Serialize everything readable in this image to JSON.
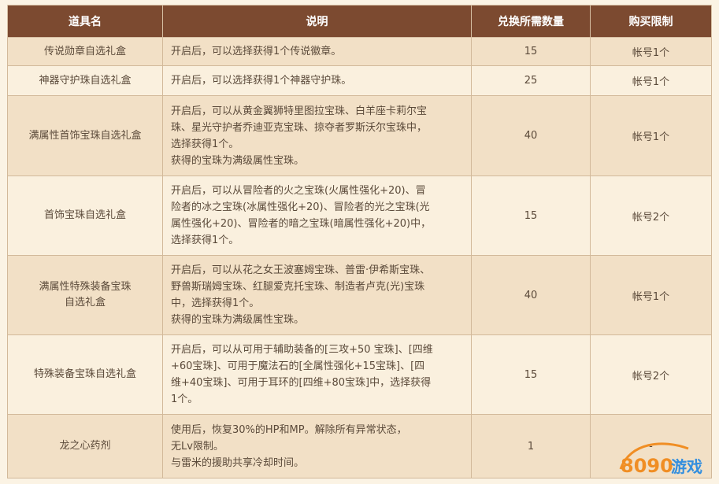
{
  "table": {
    "headers": [
      "道具名",
      "说明",
      "兑换所需数量",
      "购买限制"
    ],
    "rows": [
      {
        "name_lines": [
          "传说勋章自选礼盒"
        ],
        "desc_lines": [
          "开启后，可以选择获得1个传说徽章。"
        ],
        "qty": "15",
        "limit": "帐号1个"
      },
      {
        "name_lines": [
          "神器守护珠自选礼盒"
        ],
        "desc_lines": [
          "开启后，可以选择获得1个神器守护珠。"
        ],
        "qty": "25",
        "limit": "帐号1个"
      },
      {
        "name_lines": [
          "满属性首饰宝珠自选礼盒"
        ],
        "desc_lines": [
          "开启后，可以从黄金翼狮特里图拉宝珠、白羊座卡莉尔宝",
          "珠、星光守护者乔迪亚克宝珠、掠夺者罗斯沃尔宝珠中，",
          "选择获得1个。",
          "获得的宝珠为满级属性宝珠。"
        ],
        "qty": "40",
        "limit": "帐号1个"
      },
      {
        "name_lines": [
          "首饰宝珠自选礼盒"
        ],
        "desc_lines": [
          "开启后，可以从冒险者的火之宝珠(火属性强化+20)、冒",
          "险者的冰之宝珠(冰属性强化+20)、冒险者的光之宝珠(光",
          "属性强化+20)、冒险者的暗之宝珠(暗属性强化+20)中，",
          "选择获得1个。"
        ],
        "qty": "15",
        "limit": "帐号2个"
      },
      {
        "name_lines": [
          "满属性特殊装备宝珠",
          "自选礼盒"
        ],
        "desc_lines": [
          "开启后，可以从花之女王波塞姆宝珠、普雷·伊希斯宝珠、",
          "野兽斯瑞姆宝珠、红腿爱克托宝珠、制造者卢克(光)宝珠",
          "中，选择获得1个。",
          "获得的宝珠为满级属性宝珠。"
        ],
        "qty": "40",
        "limit": "帐号1个"
      },
      {
        "name_lines": [
          "特殊装备宝珠自选礼盒"
        ],
        "desc_lines": [
          "开启后，可以从可用于辅助装备的[三攻+50 宝珠]、[四维",
          "+60宝珠]、可用于魔法石的[全属性强化+15宝珠]、[四",
          "维+40宝珠]、可用于耳环的[四维+80宝珠]中，选择获得",
          "1个。"
        ],
        "qty": "15",
        "limit": "帐号2个"
      },
      {
        "name_lines": [
          "龙之心药剂"
        ],
        "desc_lines": [
          "使用后，恢复30%的HP和MP。解除所有异常状态，",
          "无Lv限制。",
          "与雷米的援助共享冷却时间。"
        ],
        "qty": "1",
        "limit": "-"
      }
    ]
  },
  "watermark": {
    "text": "8090游戏",
    "colors": {
      "orange": "#f08a1c",
      "blue": "#2a8be0"
    }
  }
}
